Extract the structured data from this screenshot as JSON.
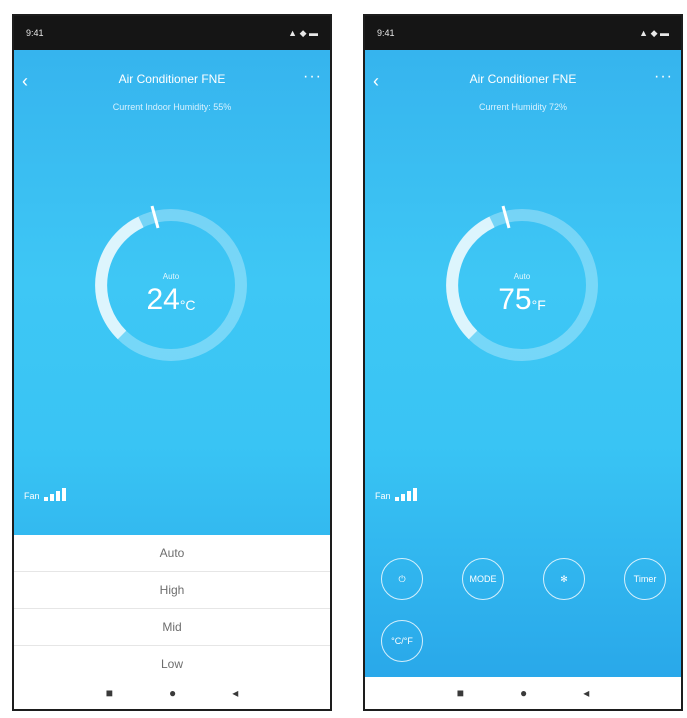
{
  "left": {
    "status": {
      "time": "9:41",
      "signal": "▲ ◆ ▬"
    },
    "title": "Air Conditioner FNE",
    "subtitle": "Current Indoor Humidity: 55%",
    "dial": {
      "mode": "Auto",
      "temp": "24",
      "unit": "°C"
    },
    "fan_label": "Fan",
    "picker_options": [
      "Auto",
      "High",
      "Mid",
      "Low"
    ],
    "nav": {
      "left": "■",
      "home": "●",
      "back": "◂"
    }
  },
  "right": {
    "status": {
      "time": "9:41",
      "signal": "▲ ◆ ▬"
    },
    "title": "Air Conditioner FNE",
    "subtitle": "Current Humidity 72%",
    "dial": {
      "mode": "Auto",
      "temp": "75",
      "unit": "°F"
    },
    "fan_label": "Fan",
    "controls": [
      "⏻",
      "MODE",
      "✻",
      "Timer",
      "°C/°F"
    ],
    "nav": {
      "left": "■",
      "home": "●",
      "back": "◂"
    }
  }
}
